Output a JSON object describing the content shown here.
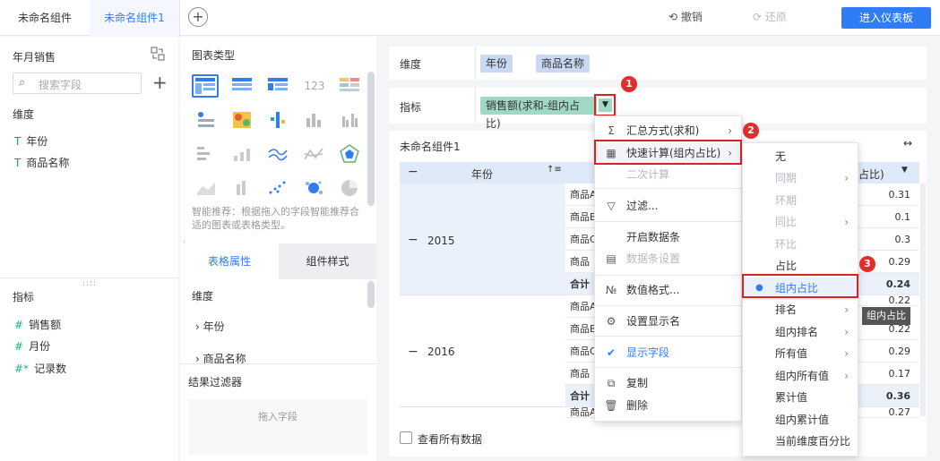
{
  "tabs": [
    "未命名组件",
    "未命名组件1"
  ],
  "toolbar": {
    "undo": "撤销",
    "redo": "还原",
    "enter_dashboard": "进入仪表板"
  },
  "left_panel": {
    "dataset_title": "年月销售",
    "search_placeholder": "搜索字段",
    "dimension_title": "维度",
    "dimensions": [
      {
        "icon": "T",
        "label": "年份"
      },
      {
        "icon": "T",
        "label": "商品名称"
      }
    ],
    "measure_title": "指标",
    "measures": [
      {
        "icon": "#",
        "label": "销售额"
      },
      {
        "icon": "#",
        "label": "月份"
      },
      {
        "icon": "#*",
        "label": "记录数"
      }
    ]
  },
  "middle_panel": {
    "chart_type_title": "图表类型",
    "smart_hint": "智能推荐：根据拖入的字段智能推荐合适的图表或表格类型。",
    "subtabs": [
      "表格属性",
      "组件样式"
    ],
    "dimension_title": "维度",
    "tree": [
      "年份",
      "商品名称"
    ],
    "filter_title": "结果过滤器",
    "drop_hint": "拖入字段"
  },
  "main": {
    "dimension_label": "维度",
    "dimension_chips": [
      "年份",
      "商品名称"
    ],
    "measure_label": "指标",
    "measure_chip": "销售额(求和-组内占比)",
    "component_title": "未命名组件1",
    "table": {
      "col_year": "年份",
      "col_value_suffix": "占比)",
      "years": [
        "2015",
        "2016"
      ],
      "rows": [
        {
          "name": "商品A",
          "value": "0.31"
        },
        {
          "name": "商品B",
          "value": "0.1"
        },
        {
          "name": "商品C",
          "value": "0.3"
        },
        {
          "name": "商品D",
          "value": "0.29"
        },
        {
          "name": "合计",
          "value": "0.24"
        },
        {
          "name": "商品A",
          "value": "0.22"
        },
        {
          "name": "商品B",
          "value": "0.22"
        },
        {
          "name": "商品C",
          "value": "0.29"
        },
        {
          "name": "商品D",
          "value": "0.17"
        },
        {
          "name": "合计",
          "value": "0.36"
        },
        {
          "name": "商品A",
          "value": "0.27"
        }
      ]
    },
    "view_all_label": "查看所有数据"
  },
  "context_menu": {
    "items": [
      "汇总方式(求和)",
      "快速计算(组内占比)",
      "二次计算",
      "过滤...",
      "开启数据条",
      "数据条设置",
      "数值格式...",
      "设置显示名",
      "显示字段",
      "复制",
      "删除"
    ]
  },
  "submenu": {
    "items": [
      "无",
      "同期",
      "环期",
      "同比",
      "环比",
      "占比",
      "组内占比",
      "排名",
      "组内排名",
      "所有值",
      "组内所有值",
      "累计值",
      "组内累计值",
      "当前维度百分比"
    ]
  },
  "tooltip": "组内占比",
  "badges": [
    "1",
    "2",
    "3"
  ],
  "colors": {
    "accent": "#2f7cf6",
    "highlight": "#e02020",
    "chip_green": "#9fd8c5"
  }
}
